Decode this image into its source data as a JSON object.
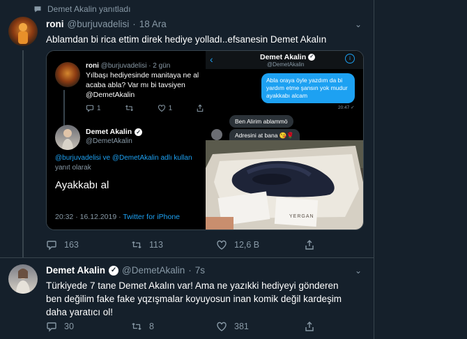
{
  "retweet_notice": "Demet Akalin yanıtladı",
  "tweet1": {
    "name": "roni",
    "handle": "@burjuvadelisi",
    "dot": "·",
    "time": "18 Ara",
    "text": "Ablamdan bi rica ettim direk hediye yolladı..efsanesin Demet Akalın",
    "replies": "163",
    "retweets": "113",
    "likes": "12,6 B"
  },
  "embedded_left": {
    "orig_name": "roni",
    "orig_handle": "@burjuvadelisi · 2 gün",
    "orig_text": "Yılbaşı hediyesinde manitaya ne al acaba abla? Var mı bi tavsiyen @DemetAkalin",
    "orig_replies": "1",
    "orig_likes": "1",
    "reply_name": "Demet Akalin",
    "reply_handle": "@DemetAkalin",
    "reply_to": "@burjuvadelisi ve @DemetAkalin adlı kullan",
    "reply_to_suffix": "yanıt olarak",
    "reply_text": "Ayakkabı al",
    "reply_meta": "20:32 · 16.12.2019 ·",
    "reply_source": "Twitter for iPhone"
  },
  "embedded_right": {
    "dm_name": "Demet Akalin",
    "dm_handle": "@DemetAkalin",
    "msg_out": "Abla oraya öyle yazdım da bi yardım etme şansın yok mudur ayakkabı alcam",
    "msg_out_time": "20:47 ✓",
    "msg_in1": "Ben Alirim ablammö",
    "msg_in2": "Adresini at bana 😘🌹",
    "box_brand": "YERGAN"
  },
  "tweet2": {
    "name": "Demet Akalin",
    "handle": "@DemetAkalin",
    "dot": "·",
    "time": "7s",
    "text": "Türkiyede 7 tane Demet Akalın var! Ama ne yazıkki hediyeyi gönderen ben değilim fake fake yqzışmalar koyuyosun inan komik değil kardeşim daha yaratıcı ol!",
    "replies": "30",
    "retweets": "8",
    "likes": "381"
  },
  "colors": {
    "bg": "#15202b",
    "muted": "#8899a6",
    "accent": "#1da1f2",
    "border": "#38444d"
  }
}
